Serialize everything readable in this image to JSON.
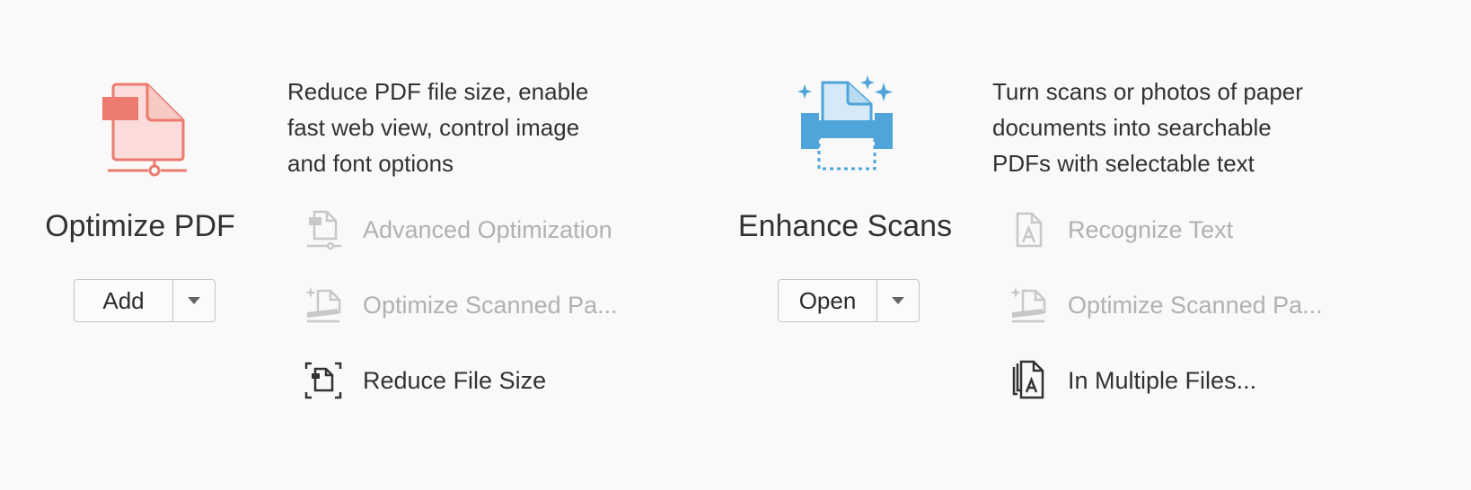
{
  "tools": [
    {
      "title": "Optimize PDF",
      "button_label": "Add",
      "description": [
        "Reduce PDF file size, enable",
        "fast web view, control image",
        "and font options"
      ],
      "icon": "optimize-pdf-icon",
      "accent": "#ec7a6f",
      "actions": [
        {
          "label": "Advanced Optimization",
          "icon": "advanced-optimization-icon",
          "enabled": false
        },
        {
          "label": "Optimize Scanned Pa...",
          "icon": "optimize-scanned-icon",
          "enabled": false
        },
        {
          "label": "Reduce File Size",
          "icon": "reduce-file-size-icon",
          "enabled": true
        }
      ]
    },
    {
      "title": "Enhance Scans",
      "button_label": "Open",
      "description": [
        "Turn scans or photos of paper",
        "documents into searchable",
        "PDFs with selectable text"
      ],
      "icon": "enhance-scans-icon",
      "accent": "#4fa4d9",
      "actions": [
        {
          "label": "Recognize Text",
          "icon": "recognize-text-icon",
          "enabled": false
        },
        {
          "label": "Optimize Scanned Pa...",
          "icon": "optimize-scanned-icon",
          "enabled": false
        },
        {
          "label": "In Multiple Files...",
          "icon": "multiple-files-icon",
          "enabled": true
        }
      ]
    }
  ]
}
